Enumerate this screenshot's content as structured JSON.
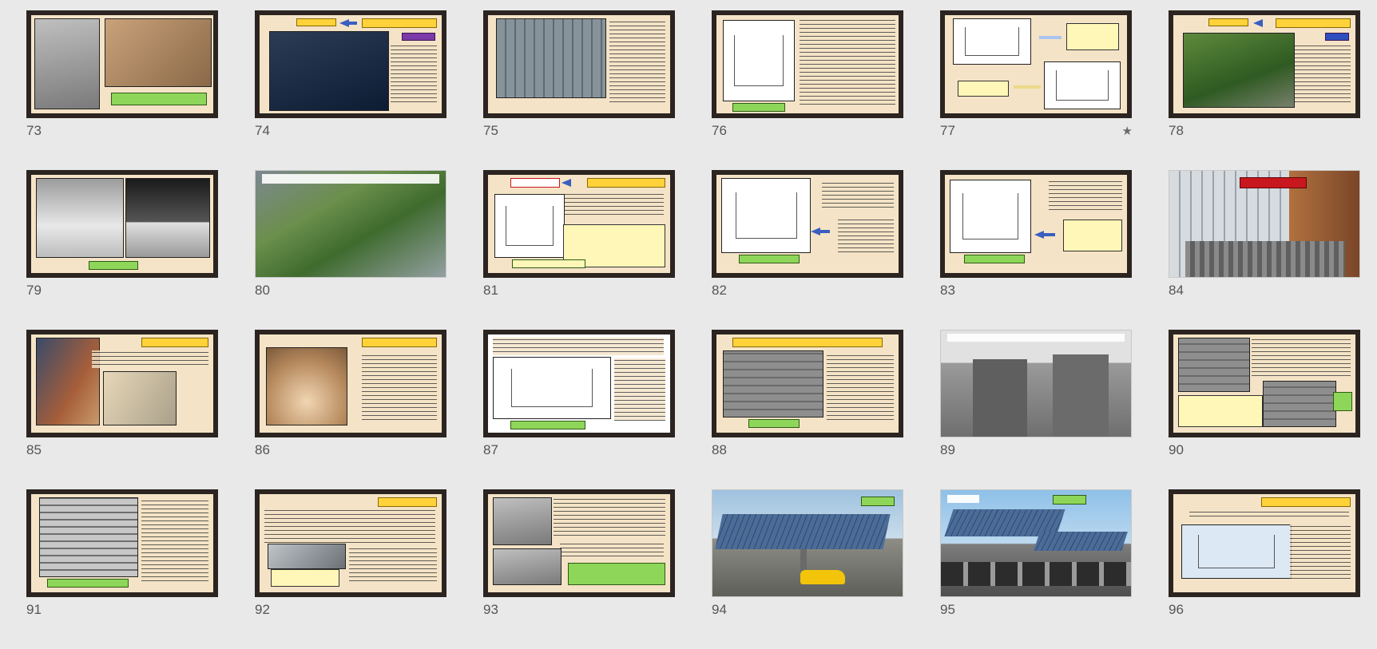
{
  "view": "slide_sorter",
  "slides": [
    {
      "number": "73"
    },
    {
      "number": "74"
    },
    {
      "number": "75"
    },
    {
      "number": "76"
    },
    {
      "number": "77",
      "starred": true
    },
    {
      "number": "78"
    },
    {
      "number": "79"
    },
    {
      "number": "80"
    },
    {
      "number": "81"
    },
    {
      "number": "82"
    },
    {
      "number": "83"
    },
    {
      "number": "84"
    },
    {
      "number": "85"
    },
    {
      "number": "86"
    },
    {
      "number": "87"
    },
    {
      "number": "88"
    },
    {
      "number": "89"
    },
    {
      "number": "90"
    },
    {
      "number": "91"
    },
    {
      "number": "92"
    },
    {
      "number": "93"
    },
    {
      "number": "94"
    },
    {
      "number": "95"
    },
    {
      "number": "96"
    }
  ],
  "icons": {
    "star": "star-icon"
  },
  "colors": {
    "frame": "#2b2420",
    "slide_bg": "#f4e3c6",
    "title_yellow": "#ffd23a",
    "tag_green": "#8ed65a",
    "arrow_blue": "#3a5fbf"
  }
}
